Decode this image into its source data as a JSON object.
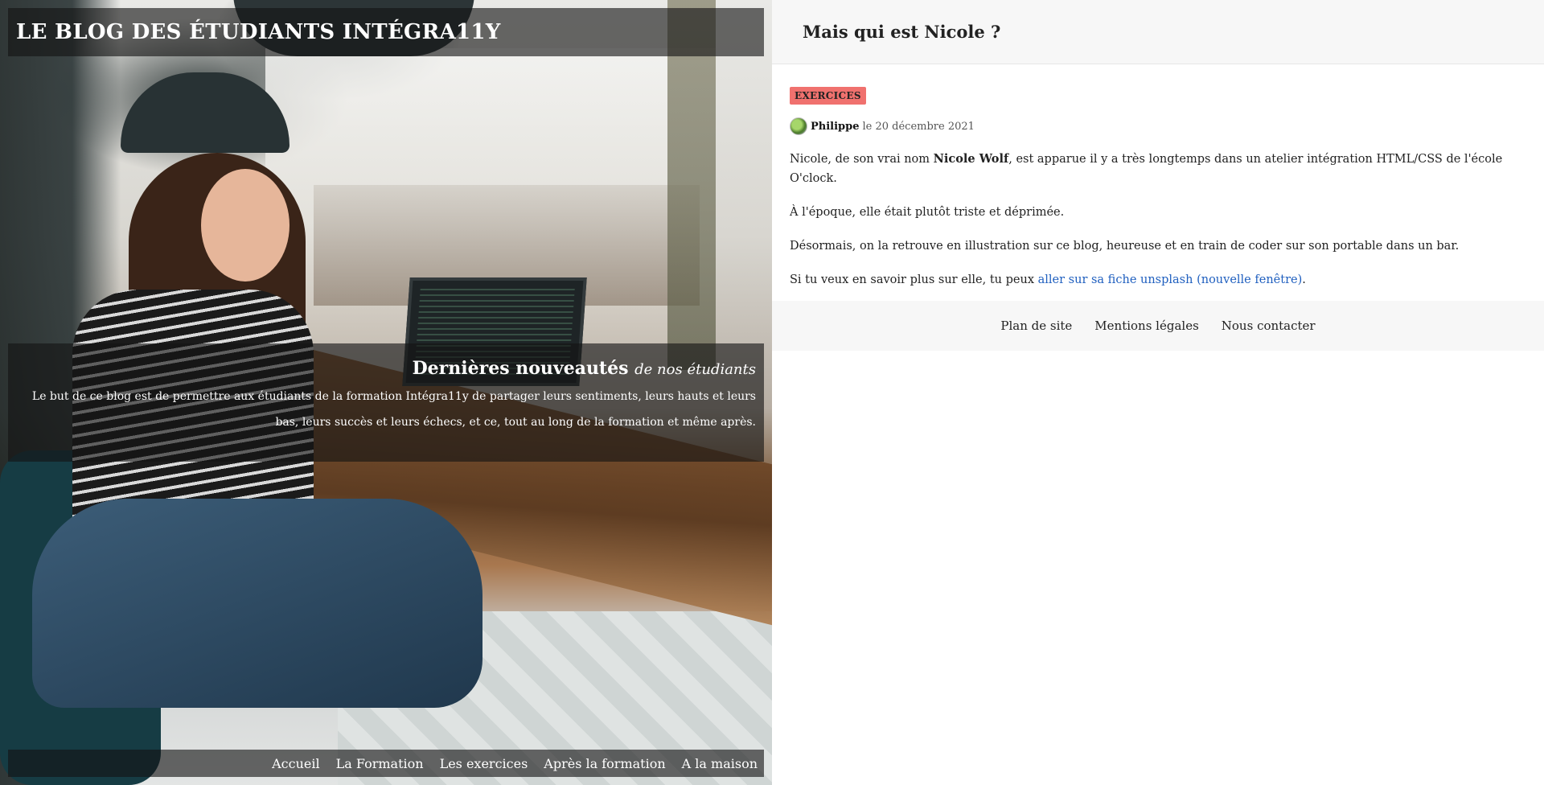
{
  "site": {
    "title": "LE BLOG DES ÉTUDIANTS INTÉGRA11Y"
  },
  "intro": {
    "heading": "Dernières nouveautés",
    "heading_em": "de nos étudiants",
    "text": "Le but de ce blog est de permettre aux étudiants de la formation Intégra11y de partager leurs sentiments, leurs hauts et leurs bas, leurs succès et leurs échecs, et ce, tout au long de la formation et même après."
  },
  "nav": {
    "items": [
      {
        "label": "Accueil"
      },
      {
        "label": "La Formation"
      },
      {
        "label": "Les exercices"
      },
      {
        "label": "Après la formation"
      },
      {
        "label": "A la maison"
      }
    ]
  },
  "article": {
    "title": "Mais qui est Nicole ?",
    "tag": "EXERCICES",
    "author": "Philippe",
    "date": "le 20 décembre 2021",
    "p1_before": "Nicole, de son vrai nom ",
    "p1_strong": "Nicole Wolf",
    "p1_after": ", est apparue il y a très longtemps dans un atelier intégration HTML/CSS de l'école O'clock.",
    "p2": "À l'époque, elle était plutôt triste et déprimée.",
    "p3": "Désormais, on la retrouve en illustration sur ce blog, heureuse et en train de coder sur son portable dans un bar.",
    "p4_before": "Si tu veux en savoir plus sur elle, tu peux ",
    "p4_link": "aller sur sa fiche unsplash (nouvelle fenêtre)",
    "p4_after": "."
  },
  "footer": {
    "links": [
      {
        "label": "Plan de site"
      },
      {
        "label": "Mentions légales"
      },
      {
        "label": "Nous contacter"
      }
    ]
  },
  "colors": {
    "tag_bg": "#f0716e",
    "link": "#1f5fbf",
    "overlay": "rgba(20,20,20,0.62)"
  }
}
